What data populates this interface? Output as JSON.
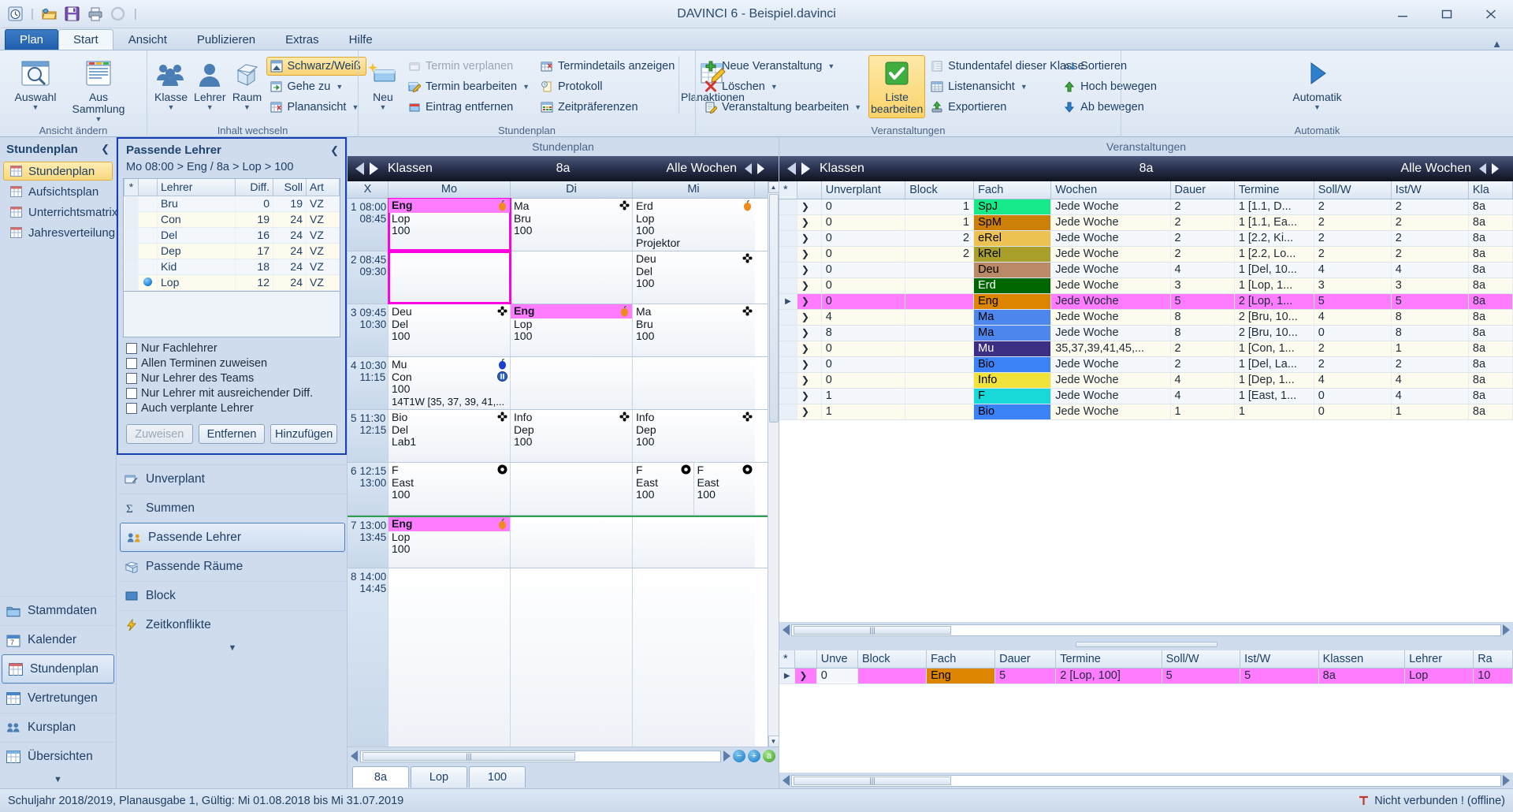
{
  "window": {
    "title": "DAVINCI 6 - Beispiel.davinci",
    "quick_access": [
      "clock-icon",
      "open-folder-icon",
      "save-icon",
      "print-icon",
      "refresh-icon"
    ],
    "buttons": {
      "minimize": "minimize-icon",
      "maximize": "maximize-icon",
      "close": "close-icon"
    }
  },
  "tabs": [
    {
      "label": "Plan",
      "kind": "file"
    },
    {
      "label": "Start",
      "kind": "active"
    },
    {
      "label": "Ansicht",
      "kind": "normal"
    },
    {
      "label": "Publizieren",
      "kind": "normal"
    },
    {
      "label": "Extras",
      "kind": "normal"
    },
    {
      "label": "Hilfe",
      "kind": "normal"
    }
  ],
  "ribbon": {
    "groups": [
      {
        "title": "Ansicht ändern",
        "big": [
          {
            "label": "Auswahl",
            "icon": "selection-search-icon",
            "dropdown": true
          },
          {
            "label": "Aus Sammlung",
            "icon": "collection-icon",
            "dropdown": true
          }
        ]
      },
      {
        "title": "Inhalt wechseln",
        "big": [
          {
            "label": "Klasse",
            "icon": "class-group-icon",
            "dropdown": true
          },
          {
            "label": "Lehrer",
            "icon": "teacher-person-icon",
            "dropdown": true
          },
          {
            "label": "Raum",
            "icon": "room-cube-icon",
            "dropdown": true
          }
        ],
        "small": [
          {
            "label": "Schwarz/Weiß",
            "icon": "black-white-icon",
            "selected": true
          },
          {
            "label": "Gehe zu",
            "icon": "goto-icon",
            "dropdown": true
          },
          {
            "label": "Planansicht",
            "icon": "planview-icon",
            "dropdown": true
          }
        ]
      },
      {
        "title": "Stundenplan",
        "big": [
          {
            "label": "Neu",
            "icon": "new-entry-icon",
            "dropdown": true
          },
          {
            "label": "Planaktionen",
            "icon": "plan-actions-icon",
            "dropdown": true
          }
        ],
        "smallA": [
          {
            "label": "Termin verplanen",
            "icon": "schedule-appointment-icon",
            "disabled": true
          },
          {
            "label": "Termin bearbeiten",
            "icon": "edit-appointment-icon",
            "dropdown": true
          },
          {
            "label": "Eintrag entfernen",
            "icon": "remove-entry-icon"
          }
        ],
        "smallB": [
          {
            "label": "Termindetails anzeigen",
            "icon": "appointment-details-icon"
          },
          {
            "label": "Protokoll",
            "icon": "protocol-icon"
          },
          {
            "label": "Zeitpräferenzen",
            "icon": "time-preferences-icon"
          }
        ]
      },
      {
        "title": "Veranstaltungen",
        "smallA": [
          {
            "label": "Neue Veranstaltung",
            "icon": "add-plus-icon",
            "dropdown": true
          },
          {
            "label": "Löschen",
            "icon": "delete-x-icon",
            "dropdown": true
          },
          {
            "label": "Veranstaltung bearbeiten",
            "icon": "edit-event-icon",
            "dropdown": true
          }
        ],
        "big": [
          {
            "label": "Liste bearbeiten",
            "icon": "green-check-icon",
            "selected": true
          }
        ],
        "smallB": [
          {
            "label": "Stundentafel dieser Klasse",
            "icon": "lesson-table-icon"
          },
          {
            "label": "Listenansicht",
            "icon": "list-view-icon",
            "dropdown": true
          },
          {
            "label": "Exportieren",
            "icon": "export-icon"
          }
        ],
        "smallC": [
          {
            "label": "Sortieren",
            "icon": "sort-icon"
          },
          {
            "label": "Hoch bewegen",
            "icon": "move-up-icon"
          },
          {
            "label": "Ab bewegen",
            "icon": "move-down-icon"
          }
        ]
      },
      {
        "title": "Automatik",
        "big": [
          {
            "label": "Automatik",
            "icon": "automatic-play-icon",
            "dropdown": true
          }
        ]
      }
    ]
  },
  "leftnav": {
    "header": "Stundenplan",
    "collapse_icon": "chevron-left-icon",
    "items": [
      {
        "label": "Stundenplan",
        "icon": "grid-icon",
        "selected": true
      },
      {
        "label": "Aufsichtsplan",
        "icon": "grid-icon",
        "selected": false
      },
      {
        "label": "Unterrichtsmatrix",
        "icon": "grid-icon",
        "selected": false
      },
      {
        "label": "Jahresverteilung",
        "icon": "grid-icon",
        "selected": false
      }
    ],
    "modules": [
      {
        "label": "Stammdaten",
        "icon": "folder-icon",
        "selected": false
      },
      {
        "label": "Kalender",
        "icon": "calendar-icon",
        "selected": false
      },
      {
        "label": "Stundenplan",
        "icon": "timetable-icon",
        "selected": true
      },
      {
        "label": "Vertretungen",
        "icon": "substitution-icon",
        "selected": false
      },
      {
        "label": "Kursplan",
        "icon": "course-icon",
        "selected": false
      },
      {
        "label": "Übersichten",
        "icon": "overview-icon",
        "selected": false
      }
    ],
    "more_icon": "chevron-down-icon"
  },
  "side_panels": {
    "collapse_icon": "chevron-down-icon",
    "items": [
      {
        "label": "Unverplant",
        "icon": "unplanned-icon",
        "selected": false
      },
      {
        "label": "Summen",
        "icon": "sigma-icon",
        "selected": false
      },
      {
        "label": "Passende Lehrer",
        "icon": "matching-teachers-icon",
        "selected": true
      },
      {
        "label": "Passende Räume",
        "icon": "matching-rooms-icon",
        "selected": false
      },
      {
        "label": "Block",
        "icon": "block-icon",
        "selected": false
      },
      {
        "label": "Zeitkonflikte",
        "icon": "time-conflict-icon",
        "selected": false
      }
    ]
  },
  "passende_lehrer": {
    "title": "Passende Lehrer",
    "collapse_icon": "chevron-left-icon",
    "path": "Mo 08:00 > Eng / 8a > Lop > 100",
    "columns": [
      "*",
      "",
      "Lehrer",
      "Diff.",
      "Soll",
      "Art"
    ],
    "rows": [
      {
        "dot": false,
        "lehrer": "Bru",
        "diff": "0",
        "soll": "19",
        "art": "VZ"
      },
      {
        "dot": false,
        "lehrer": "Con",
        "diff": "19",
        "soll": "24",
        "art": "VZ"
      },
      {
        "dot": false,
        "lehrer": "Del",
        "diff": "16",
        "soll": "24",
        "art": "VZ"
      },
      {
        "dot": false,
        "lehrer": "Dep",
        "diff": "17",
        "soll": "24",
        "art": "VZ"
      },
      {
        "dot": false,
        "lehrer": "Kid",
        "diff": "18",
        "soll": "24",
        "art": "VZ"
      },
      {
        "dot": true,
        "lehrer": "Lop",
        "diff": "12",
        "soll": "24",
        "art": "VZ"
      }
    ],
    "checkboxes": [
      {
        "label": "Nur Fachlehrer",
        "checked": false
      },
      {
        "label": "Allen Terminen zuweisen",
        "checked": false
      },
      {
        "label": "Nur Lehrer des Teams",
        "checked": false
      },
      {
        "label": "Nur Lehrer mit ausreichender Diff.",
        "checked": false
      },
      {
        "label": "Auch verplante Lehrer",
        "checked": false
      }
    ],
    "buttons": [
      {
        "label": "Zuweisen",
        "disabled": true
      },
      {
        "label": "Entfernen",
        "disabled": false
      },
      {
        "label": "Hinzufügen",
        "disabled": false
      }
    ]
  },
  "timetable": {
    "section_title": "Stundenplan",
    "header": {
      "entity": "Klassen",
      "selection": "8a",
      "weeks": "Alle Wochen",
      "prev_icon": "left-triangle-icon",
      "next_icon": "right-triangle-icon"
    },
    "day_columns": [
      "X",
      "Mo",
      "Di",
      "Mi"
    ],
    "rows": [
      {
        "no": "1",
        "from": "08:00",
        "to": "08:45",
        "cells": [
          {
            "subject": "Eng",
            "teacher": "Lop",
            "room": "100",
            "highlight": true,
            "selected": true,
            "badge": "apple-orange-icon"
          },
          {
            "subject": "Ma",
            "teacher": "Bru",
            "room": "100",
            "highlight": false,
            "badge": "flower-black-icon"
          },
          {
            "subject": "Erd",
            "teacher": "Lop",
            "room": "100",
            "extra": "Projektor",
            "highlight": false,
            "badge": "apple-orange-icon"
          }
        ]
      },
      {
        "no": "2",
        "from": "08:45",
        "to": "09:30",
        "cells": [
          {
            "subject": "",
            "teacher": "",
            "room": "",
            "selected": true
          },
          {
            "subject": "",
            "teacher": "",
            "room": ""
          },
          {
            "subject": "Deu",
            "teacher": "Del",
            "room": "100",
            "badge": "flower-black-icon"
          }
        ]
      },
      {
        "no": "3",
        "from": "09:45",
        "to": "10:30",
        "cells": [
          {
            "subject": "Deu",
            "teacher": "Del",
            "room": "100",
            "badge": "flower-black-icon"
          },
          {
            "subject": "Eng",
            "teacher": "Lop",
            "room": "100",
            "highlight": true,
            "badge": "apple-orange-icon"
          },
          {
            "subject": "Ma",
            "teacher": "Bru",
            "room": "100",
            "badge": "flower-black-icon"
          }
        ]
      },
      {
        "no": "4",
        "from": "10:30",
        "to": "11:15",
        "cells": [
          {
            "subject": "Mu",
            "teacher": "Con",
            "room": "100",
            "extra": "14T1W [35, 37, 39, 41,...",
            "badge": "apple-blue-icon",
            "badge2": "pause-blue-icon"
          },
          {
            "subject": "",
            "teacher": "",
            "room": ""
          },
          {
            "subject": "",
            "teacher": "",
            "room": ""
          }
        ]
      },
      {
        "no": "5",
        "from": "11:30",
        "to": "12:15",
        "cells": [
          {
            "subject": "Bio",
            "teacher": "Del",
            "room": "Lab1",
            "badge": "flower-black-icon"
          },
          {
            "subject": "Info",
            "teacher": "Dep",
            "room": "100",
            "badge": "flower-black-icon"
          },
          {
            "subject": "Info",
            "teacher": "Dep",
            "room": "100",
            "badge": "flower-black-icon"
          }
        ]
      },
      {
        "no": "6",
        "from": "12:15",
        "to": "13:00",
        "cells": [
          {
            "subject": "F",
            "teacher": "East",
            "room": "100",
            "badge": "dot-black-icon"
          },
          {
            "subject": "",
            "teacher": "",
            "room": ""
          },
          {
            "split": true,
            "left": {
              "subject": "F",
              "teacher": "East",
              "room": "100",
              "badge": "dot-black-icon"
            },
            "right": {
              "subject": "F",
              "teacher": "East",
              "room": "100",
              "badge": "dot-black-icon"
            }
          }
        ]
      },
      {
        "no": "7",
        "from": "13:00",
        "to": "13:45",
        "cells": [
          {
            "subject": "Eng",
            "teacher": "Lop",
            "room": "100",
            "highlight": true,
            "badge": "apple-orange-icon"
          },
          {
            "subject": "",
            "teacher": "",
            "room": ""
          },
          {
            "subject": "",
            "teacher": "",
            "room": ""
          }
        ]
      },
      {
        "no": "8",
        "from": "14:00",
        "to": "14:45",
        "cells": [
          {
            "subject": "",
            "teacher": "",
            "room": ""
          },
          {
            "subject": "",
            "teacher": "",
            "room": ""
          },
          {
            "subject": "",
            "teacher": "",
            "room": ""
          }
        ]
      }
    ],
    "footer_tabs": [
      {
        "label": "8a",
        "active": true
      },
      {
        "label": "Lop",
        "active": false
      },
      {
        "label": "100",
        "active": false
      }
    ],
    "zoom_buttons": [
      "zoom-out-icon",
      "zoom-in-icon",
      "fit-a-icon"
    ]
  },
  "events": {
    "section_title": "Veranstaltungen",
    "header": {
      "entity": "Klassen",
      "selection": "8a",
      "weeks": "Alle Wochen",
      "prev_icon": "left-triangle-icon",
      "next_icon": "right-triangle-icon"
    },
    "columns": [
      "*",
      "",
      "Unverplant",
      "Block",
      "Fach",
      "Wochen",
      "Dauer",
      "Termine",
      "Soll/W",
      "Ist/W",
      "Kla"
    ],
    "rows": [
      {
        "unverplant": "0",
        "block": "1",
        "fach": "SpJ",
        "fach_color": "#16e98a",
        "fach_text": "#000000",
        "wochen": "Jede Woche",
        "dauer": "2",
        "termine": "1 [1.1, D...",
        "soll": "2",
        "ist": "2",
        "klasse": "8a"
      },
      {
        "unverplant": "0",
        "block": "1",
        "fach": "SpM",
        "fach_color": "#cc8008",
        "fach_text": "#000000",
        "wochen": "Jede Woche",
        "dauer": "2",
        "termine": "1 [1.1, Ea...",
        "soll": "2",
        "ist": "2",
        "klasse": "8a"
      },
      {
        "unverplant": "0",
        "block": "2",
        "fach": "eRel",
        "fach_color": "#ecc252",
        "fach_text": "#000000",
        "wochen": "Jede Woche",
        "dauer": "2",
        "termine": "1 [2.2, Ki...",
        "soll": "2",
        "ist": "2",
        "klasse": "8a"
      },
      {
        "unverplant": "0",
        "block": "2",
        "fach": "kRel",
        "fach_color": "#a9a02c",
        "fach_text": "#000000",
        "wochen": "Jede Woche",
        "dauer": "2",
        "termine": "1 [2.2, Lo...",
        "soll": "2",
        "ist": "2",
        "klasse": "8a"
      },
      {
        "unverplant": "0",
        "block": "",
        "fach": "Deu",
        "fach_color": "#b98968",
        "fach_text": "#000000",
        "wochen": "Jede Woche",
        "dauer": "4",
        "termine": "1 [Del, 10...",
        "soll": "4",
        "ist": "4",
        "klasse": "8a"
      },
      {
        "unverplant": "0",
        "block": "",
        "fach": "Erd",
        "fach_color": "#006600",
        "fach_text": "#ffffff",
        "wochen": "Jede Woche",
        "dauer": "3",
        "termine": "1 [Lop, 1...",
        "soll": "3",
        "ist": "3",
        "klasse": "8a"
      },
      {
        "unverplant": "0",
        "block": "",
        "fach": "Eng",
        "fach_color": "#dd8500",
        "fach_text": "#000000",
        "wochen": "Jede Woche",
        "dauer": "5",
        "termine": "2 [Lop, 1...",
        "soll": "5",
        "ist": "5",
        "klasse": "8a",
        "selected": true
      },
      {
        "unverplant": "4",
        "block": "",
        "fach": "Ma",
        "fach_color": "#4d87ee",
        "fach_text": "#000000",
        "wochen": "Jede Woche",
        "dauer": "8",
        "termine": "2 [Bru, 10...",
        "soll": "4",
        "ist": "8",
        "klasse": "8a"
      },
      {
        "unverplant": "8",
        "block": "",
        "fach": "Ma",
        "fach_color": "#4d87ee",
        "fach_text": "#000000",
        "wochen": "Jede Woche",
        "dauer": "8",
        "termine": "2 [Bru, 10...",
        "soll": "0",
        "ist": "8",
        "klasse": "8a"
      },
      {
        "unverplant": "0",
        "block": "",
        "fach": "Mu",
        "fach_color": "#3c2f83",
        "fach_text": "#ffffff",
        "wochen": "35,37,39,41,45,...",
        "dauer": "2",
        "termine": "1 [Con, 1...",
        "soll": "2",
        "ist": "1",
        "klasse": "8a"
      },
      {
        "unverplant": "0",
        "block": "",
        "fach": "Bio",
        "fach_color": "#3b82f6",
        "fach_text": "#000000",
        "wochen": "Jede Woche",
        "dauer": "2",
        "termine": "1 [Del, La...",
        "soll": "2",
        "ist": "2",
        "klasse": "8a"
      },
      {
        "unverplant": "0",
        "block": "",
        "fach": "Info",
        "fach_color": "#f2e33a",
        "fach_text": "#000000",
        "wochen": "Jede Woche",
        "dauer": "4",
        "termine": "1 [Dep, 1...",
        "soll": "4",
        "ist": "4",
        "klasse": "8a"
      },
      {
        "unverplant": "1",
        "block": "",
        "fach": "F",
        "fach_color": "#18d8d8",
        "fach_text": "#000000",
        "wochen": "Jede Woche",
        "dauer": "4",
        "termine": "1 [East, 1...",
        "soll": "0",
        "ist": "4",
        "klasse": "8a"
      },
      {
        "unverplant": "1",
        "block": "",
        "fach": "Bio",
        "fach_color": "#3b82f6",
        "fach_text": "#000000",
        "wochen": "Jede Woche",
        "dauer": "1",
        "termine": "1",
        "soll": "0",
        "ist": "1",
        "klasse": "8a"
      }
    ],
    "detail": {
      "columns": [
        "*",
        "",
        "Unve",
        "Block",
        "Fach",
        "Dauer",
        "Termine",
        "Soll/W",
        "Ist/W",
        "Klassen",
        "Lehrer",
        "Ra"
      ],
      "rows": [
        {
          "unve": "0",
          "block": "",
          "fach": "Eng",
          "fach_color": "#dd8500",
          "dauer": "5",
          "termine": "2 [Lop, 100]",
          "soll": "5",
          "ist": "5",
          "klassen": "8a",
          "lehrer": "Lop",
          "raum": "10"
        }
      ]
    }
  },
  "status": {
    "left": "Schuljahr 2018/2019, Planausgabe 1, Gültig: Mi 01.08.2018 bis Mi 31.07.2019",
    "right": "Nicht verbunden ! (offline)",
    "right_icon": "disconnected-icon"
  },
  "colors": {
    "accent_blue": "#1a3fb5",
    "highlight_magenta": "#ff7bff",
    "selection_gold": "#f9d475",
    "header_dark": "#10131f"
  }
}
